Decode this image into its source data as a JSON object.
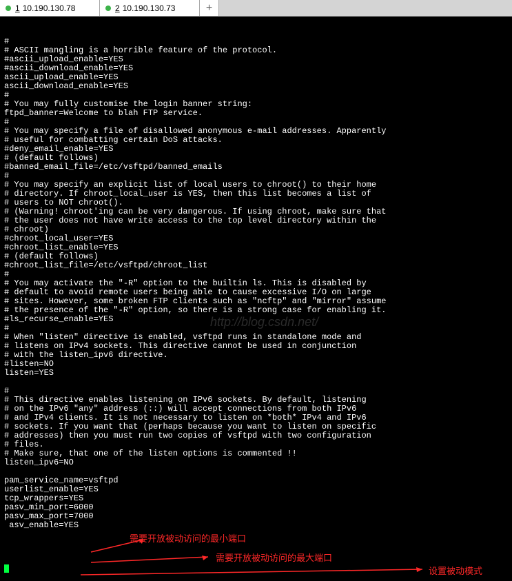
{
  "tabs": [
    {
      "num": "1",
      "ip": "10.190.130.78"
    },
    {
      "num": "2",
      "ip": "10.190.130.73"
    }
  ],
  "add_tab": "+",
  "terminal_lines": [
    "#",
    "# ASCII mangling is a horrible feature of the protocol.",
    "#ascii_upload_enable=YES",
    "#ascii_download_enable=YES",
    "ascii_upload_enable=YES",
    "ascii_download_enable=YES",
    "#",
    "# You may fully customise the login banner string:",
    "ftpd_banner=Welcome to blah FTP service.",
    "#",
    "# You may specify a file of disallowed anonymous e-mail addresses. Apparently",
    "# useful for combatting certain DoS attacks.",
    "#deny_email_enable=YES",
    "# (default follows)",
    "#banned_email_file=/etc/vsftpd/banned_emails",
    "#",
    "# You may specify an explicit list of local users to chroot() to their home",
    "# directory. If chroot_local_user is YES, then this list becomes a list of",
    "# users to NOT chroot().",
    "# (Warning! chroot'ing can be very dangerous. If using chroot, make sure that",
    "# the user does not have write access to the top level directory within the",
    "# chroot)",
    "#chroot_local_user=YES",
    "#chroot_list_enable=YES",
    "# (default follows)",
    "#chroot_list_file=/etc/vsftpd/chroot_list",
    "#",
    "# You may activate the \"-R\" option to the builtin ls. This is disabled by",
    "# default to avoid remote users being able to cause excessive I/O on large",
    "# sites. However, some broken FTP clients such as \"ncftp\" and \"mirror\" assume",
    "# the presence of the \"-R\" option, so there is a strong case for enabling it.",
    "#ls_recurse_enable=YES",
    "#",
    "# When \"listen\" directive is enabled, vsftpd runs in standalone mode and",
    "# listens on IPv4 sockets. This directive cannot be used in conjunction",
    "# with the listen_ipv6 directive.",
    "#listen=NO",
    "listen=YES",
    "",
    "#",
    "# This directive enables listening on IPv6 sockets. By default, listening",
    "# on the IPv6 \"any\" address (::) will accept connections from both IPv6",
    "# and IPv4 clients. It is not necessary to listen on *both* IPv4 and IPv6",
    "# sockets. If you want that (perhaps because you want to listen on specific",
    "# addresses) then you must run two copies of vsftpd with two configuration",
    "# files.",
    "# Make sure, that one of the listen options is commented !!",
    "listen_ipv6=NO",
    "",
    "pam_service_name=vsftpd",
    "userlist_enable=YES",
    "tcp_wrappers=YES",
    "pasv_min_port=6000",
    "pasv_max_port=7000",
    " asv_enable=YES"
  ],
  "watermark": "http://blog.csdn.net/",
  "annotations": {
    "min_port": "需要开放被动访问的最小端口",
    "max_port": "需要开放被动访问的最大端口",
    "pasv_mode": "设置被动模式"
  }
}
